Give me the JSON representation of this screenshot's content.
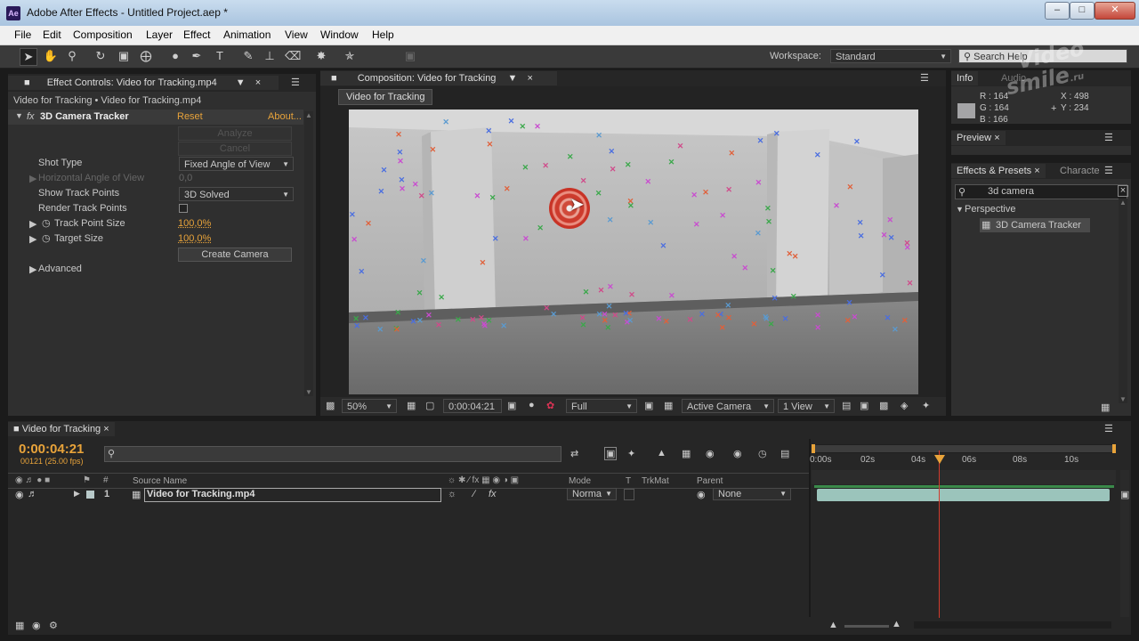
{
  "window": {
    "title": "Adobe After Effects - Untitled Project.aep *",
    "app_icon": "Ae"
  },
  "menu": [
    "File",
    "Edit",
    "Composition",
    "Layer",
    "Effect",
    "Animation",
    "View",
    "Window",
    "Help"
  ],
  "toolbar": {
    "workspace_label": "Workspace:",
    "workspace_value": "Standard",
    "search_placeholder": "Search Help"
  },
  "effect_controls": {
    "tab_label": "Effect Controls: Video for Tracking.mp4",
    "breadcrumb": "Video for Tracking • Video for Tracking.mp4",
    "effect_name": "3D Camera Tracker",
    "reset_label": "Reset",
    "about_label": "About...",
    "analyze_label": "Analyze",
    "cancel_label": "Cancel",
    "props": {
      "shot_type_label": "Shot Type",
      "shot_type_value": "Fixed Angle of View",
      "hfov_label": "Horizontal Angle of View",
      "hfov_value": "0,0",
      "show_track_points_label": "Show Track Points",
      "show_track_points_value": "3D Solved",
      "render_track_points_label": "Render Track Points",
      "track_point_size_label": "Track Point Size",
      "track_point_size_value": "100,0%",
      "target_size_label": "Target Size",
      "target_size_value": "100,0%",
      "create_camera_label": "Create Camera",
      "advanced_label": "Advanced"
    }
  },
  "composition": {
    "tab_label": "Composition: Video for Tracking",
    "sub_tab_label": "Video for Tracking",
    "zoom": "50%",
    "timecode": "0:00:04:21",
    "resolution": "Full",
    "camera": "Active Camera",
    "views": "1 View"
  },
  "info": {
    "tab_label": "Info",
    "audio_tab_label": "Audio",
    "r_label": "R : 164",
    "g_label": "G : 164",
    "b_label": "B : 166",
    "x_label": "X : 498",
    "y_label": "Y : 234",
    "swatch_color": "#a4a4a6"
  },
  "preview": {
    "tab_label": "Preview"
  },
  "effects_presets": {
    "tab_label": "Effects & Presets",
    "character_tab_label": "Characte",
    "search_value": "3d camera",
    "category": "Perspective",
    "item": "3D Camera Tracker"
  },
  "timeline": {
    "tab_label": "Video for Tracking",
    "timecode": "0:00:04:21",
    "frame_info": "00121 (25.00 fps)",
    "columns": {
      "number": "#",
      "source_name": "Source Name",
      "mode": "Mode",
      "t": "T",
      "trkmat": "TrkMat",
      "parent": "Parent"
    },
    "layer": {
      "number": "1",
      "name": "Video for Tracking.mp4",
      "mode": "Norma",
      "parent": "None"
    },
    "ruler": [
      "0:00s",
      "02s",
      "04s",
      "06s",
      "08s",
      "10s"
    ]
  },
  "watermark": {
    "line1": "Video",
    "line2": "smile",
    "suffix": ".ru"
  }
}
